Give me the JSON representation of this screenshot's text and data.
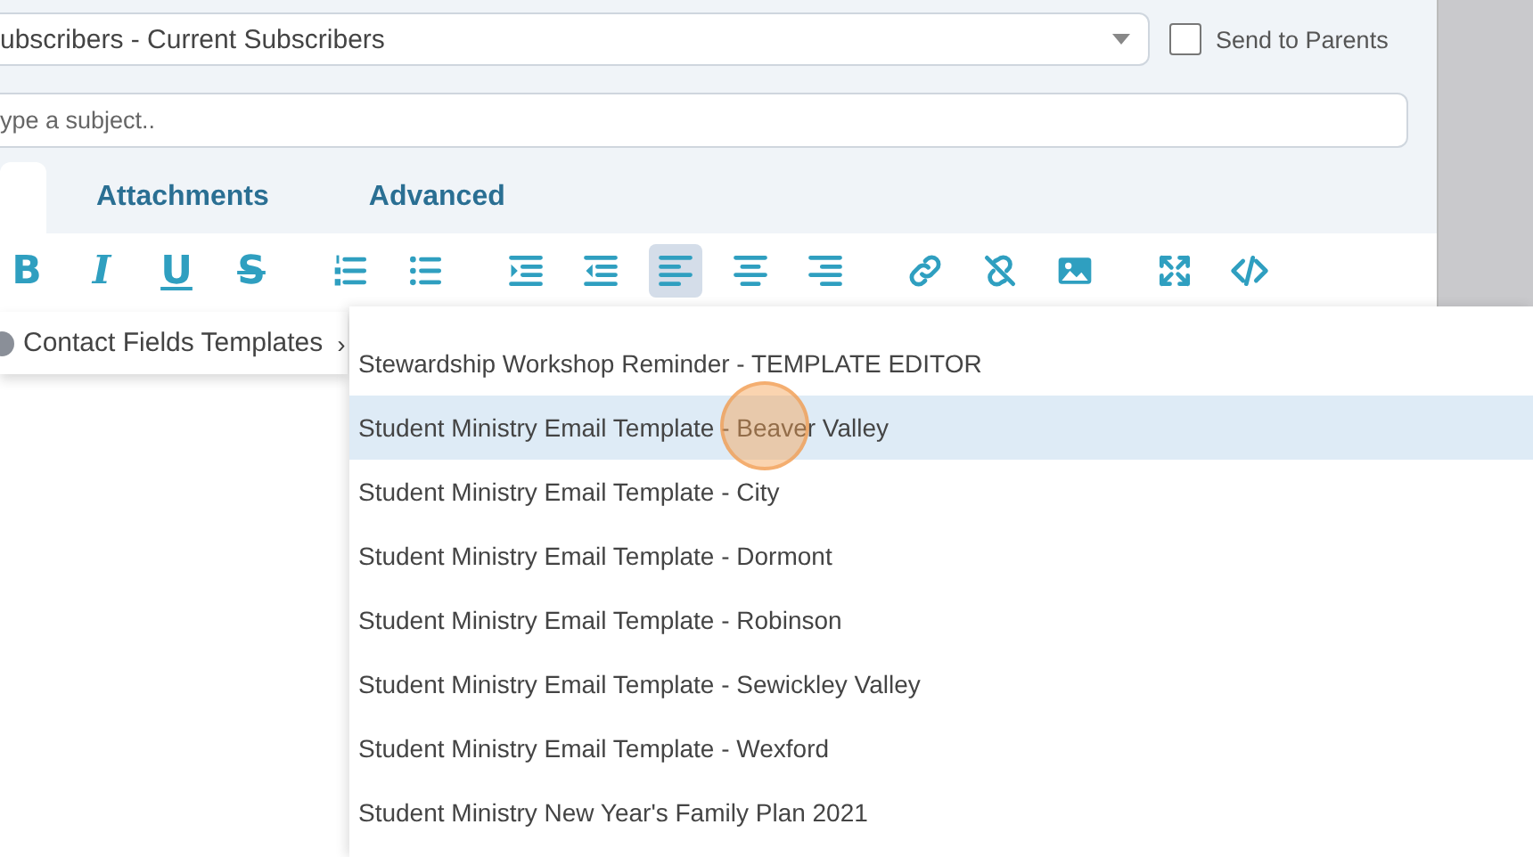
{
  "recipients": {
    "value": "ubscribers - Current Subscribers"
  },
  "send_to_parents": {
    "label": "Send to Parents",
    "checked": false
  },
  "subject": {
    "placeholder": "ype a subject.."
  },
  "tabs": [
    {
      "selected": true
    },
    {
      "label": "Attachments",
      "selected": false
    },
    {
      "label": "Advanced",
      "selected": false
    }
  ],
  "toolbar": [
    [
      {
        "kind": "bold",
        "glyph": "B",
        "active": false
      },
      {
        "kind": "italic",
        "glyph": "I",
        "active": false
      },
      {
        "kind": "underline",
        "glyph": "U",
        "active": false
      },
      {
        "kind": "strike",
        "glyph": "S",
        "active": false
      }
    ],
    [
      {
        "kind": "ol",
        "active": false
      },
      {
        "kind": "ul",
        "active": false
      }
    ],
    [
      {
        "kind": "indent",
        "active": false
      },
      {
        "kind": "outdent",
        "active": false
      },
      {
        "kind": "align-left",
        "active": true
      },
      {
        "kind": "align-center",
        "active": false
      },
      {
        "kind": "align-right",
        "active": false
      }
    ],
    [
      {
        "kind": "link",
        "active": false
      },
      {
        "kind": "unlink",
        "active": false
      },
      {
        "kind": "image",
        "active": false
      }
    ],
    [
      {
        "kind": "fullscreen",
        "active": false
      },
      {
        "kind": "code",
        "active": false
      }
    ]
  ],
  "menu": {
    "label": "Contact Fields Templates",
    "arrow": "›"
  },
  "submenu": [
    {
      "label": "Stewardship Workshop Reminder - TEMPLATE EDITOR",
      "selected": false
    },
    {
      "label": "Student Ministry Email Template - Beaver Valley",
      "selected": true
    },
    {
      "label": "Student Ministry Email Template - City",
      "selected": false
    },
    {
      "label": "Student Ministry Email Template - Dormont",
      "selected": false
    },
    {
      "label": "Student Ministry Email Template - Robinson",
      "selected": false
    },
    {
      "label": "Student Ministry Email Template - Sewickley Valley",
      "selected": false
    },
    {
      "label": "Student Ministry Email Template - Wexford",
      "selected": false
    },
    {
      "label": "Student Ministry New Year's Family Plan 2021",
      "selected": false
    }
  ]
}
